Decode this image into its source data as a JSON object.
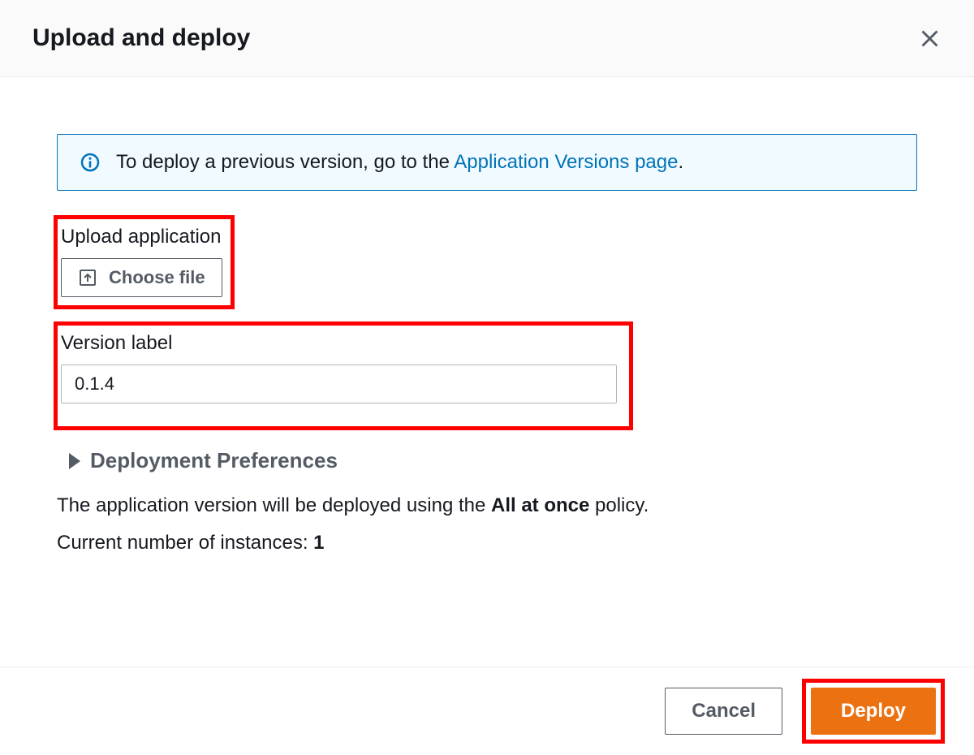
{
  "modal": {
    "title": "Upload and deploy"
  },
  "info": {
    "text_before": "To deploy a previous version, go to the ",
    "link_text": "Application Versions page",
    "text_after": "."
  },
  "upload": {
    "label": "Upload application",
    "button": "Choose file"
  },
  "version": {
    "label": "Version label",
    "value": "0.1.4"
  },
  "prefs": {
    "title": "Deployment Preferences"
  },
  "policy": {
    "text_before": "The application version will be deployed using the ",
    "policy_name": "All at once",
    "text_after": " policy."
  },
  "instances": {
    "text": "Current number of instances: ",
    "count": "1"
  },
  "footer": {
    "cancel": "Cancel",
    "deploy": "Deploy"
  }
}
